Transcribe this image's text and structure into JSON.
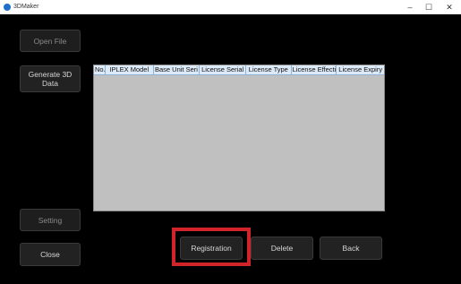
{
  "window": {
    "title": "3DMaker",
    "minimize_label": "–",
    "maximize_label": "☐",
    "close_label": "✕"
  },
  "sidebar": {
    "open_file": "Open File",
    "generate_3d": "Generate 3D Data",
    "setting": "Setting",
    "close": "Close"
  },
  "table": {
    "columns": [
      "No.",
      "IPLEX Model",
      "Base Unit Seri",
      "License Serial",
      "License Type",
      "License Effecti",
      "License Expiry"
    ],
    "rows": []
  },
  "actions": {
    "registration": "Registration",
    "delete": "Delete",
    "back": "Back"
  },
  "colors": {
    "highlight": "#d0232a",
    "grid_background": "#c0c0c0",
    "header_background": "#dce9f7"
  }
}
